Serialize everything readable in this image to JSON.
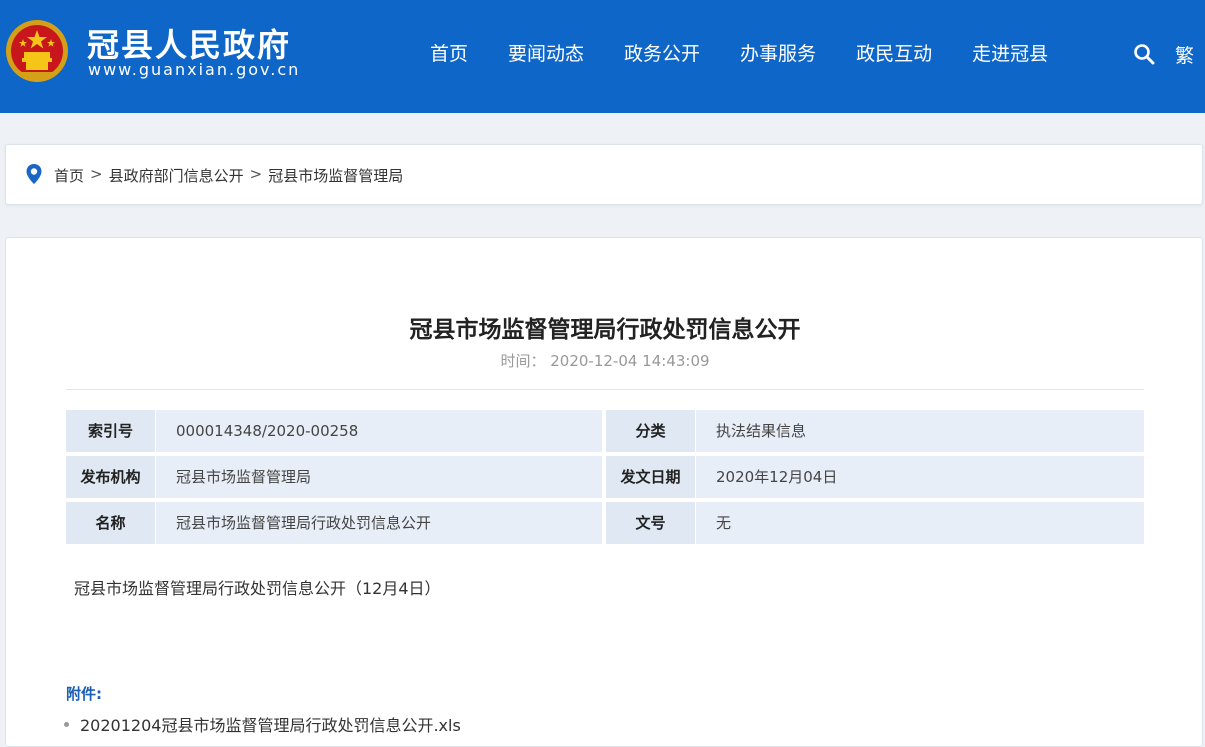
{
  "header": {
    "site_title": "冠县人民政府",
    "site_domain": "www.guanxian.gov.cn",
    "nav": [
      "首页",
      "要闻动态",
      "政务公开",
      "办事服务",
      "政民互动",
      "走进冠县"
    ],
    "lang_toggle": "繁",
    "bg_color": "#0d66c8"
  },
  "breadcrumb": {
    "items": [
      "首页",
      "县政府部门信息公开",
      "冠县市场监督管理局"
    ],
    "separator": ">"
  },
  "article": {
    "title": "冠县市场监督管理局行政处罚信息公开",
    "time_label": "时间：",
    "time_value": "2020-12-04 14:43:09",
    "meta": [
      {
        "label": "索引号",
        "value": "000014348/2020-00258",
        "label2": "分类",
        "value2": "执法结果信息"
      },
      {
        "label": "发布机构",
        "value": "冠县市场监督管理局",
        "label2": "发文日期",
        "value2": "2020年12月04日"
      },
      {
        "label": "名称",
        "value": "冠县市场监督管理局行政处罚信息公开",
        "label2": "文号",
        "value2": "无"
      }
    ],
    "summary": "冠县市场监督管理局行政处罚信息公开（12月4日）",
    "attachments_label": "附件:",
    "attachments": [
      "20201204冠县市场监督管理局行政处罚信息公开.xls"
    ]
  }
}
